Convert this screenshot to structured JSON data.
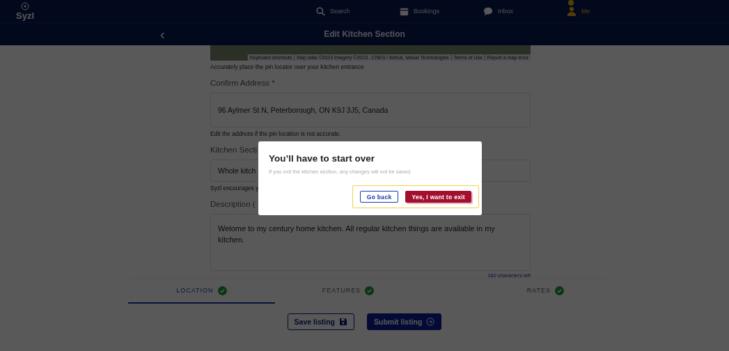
{
  "app": {
    "logo": "Syzl"
  },
  "nav": [
    {
      "label": "Search",
      "notification": false
    },
    {
      "label": "Bookings",
      "notification": false
    },
    {
      "label": "Inbox",
      "notification": false
    },
    {
      "label": "Me",
      "notification": true
    }
  ],
  "subheader": {
    "title": "Edit Kitchen Section",
    "back": "‹"
  },
  "map": {
    "attribution": [
      "Keyboard shortcuts",
      "Map data ©2023 Imagery ©2023 , CNES / Airbus, Maxar Technologies",
      "Terms of Use",
      "Report a map error"
    ]
  },
  "form": {
    "map_hint": "Accurately place the pin locator over your kitchen entrance",
    "fields": [
      {
        "kind": "input",
        "label": "Confirm Address",
        "required_mark": "*",
        "value": "96 Aylmer St N, Peterborough, ON K9J 3J5, Canada",
        "hint": "Edit the address if the pin location is not accurate."
      },
      {
        "kind": "input",
        "label": "Kitchen Secti",
        "value": "Whole kitch",
        "hint": "Syzl encourages y"
      },
      {
        "kind": "textarea",
        "label": "Description (",
        "value": "Welome to my century home kitchen. All regular kitchen things are available in my kitchen.",
        "counter": "160 characters left"
      }
    ]
  },
  "steps": [
    {
      "label": "LOCATION",
      "selected": true,
      "completed": true
    },
    {
      "label": "FEATURES",
      "selected": false,
      "completed": true
    },
    {
      "label": "RATES",
      "selected": false,
      "completed": true
    }
  ],
  "actions": [
    {
      "label": "Save listing",
      "kind": "outline"
    },
    {
      "label": "Submit listing",
      "kind": "filled"
    }
  ],
  "dialog": {
    "title": "You’ll have to start over",
    "message": "If you exit the kitchen section, any changes will not be saved.",
    "buttons": [
      {
        "label": "Go back",
        "kind": "outline"
      },
      {
        "label": "Yes, I want to exit",
        "kind": "danger"
      }
    ]
  }
}
